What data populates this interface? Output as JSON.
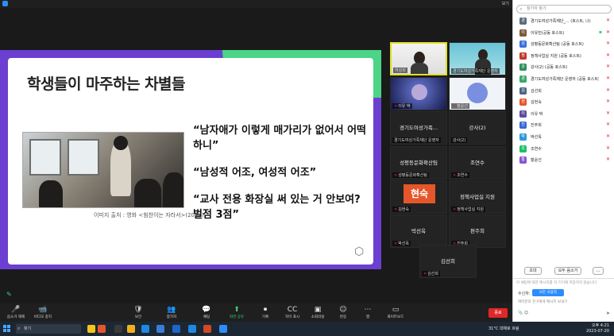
{
  "window": {
    "view_label": "보기"
  },
  "slide": {
    "title": "학생들이 마주하는 차별들",
    "caption": "이미지 출처 : 영화 <힘찬이는 자라서>(2022)",
    "quotes": [
      "“남자애가 이렇게 매가리가 없어서 어떡",
      "하니”",
      "“남성적 어조, 여성적 어조”",
      "“교사 전용 화장실 써 있는 거 안보여?",
      "벌점 3점”"
    ]
  },
  "gallery": [
    {
      "label": "여성희",
      "type": "cam1",
      "active": true
    },
    {
      "label": "경기도여성가족재단 운영자",
      "type": "cam2",
      "active": false
    },
    {
      "label": "이유 박",
      "type": "cam3",
      "active": false
    },
    {
      "label": "황윤선",
      "type": "cam4",
      "active": false
    },
    {
      "name": "경기도여성가족...",
      "label": "경기도여성가족재단 운영자",
      "type": "name"
    },
    {
      "name": "강사(2)",
      "label": "강사(2)",
      "type": "name"
    },
    {
      "name": "성평등문화확산팀",
      "label": "성평등문화확산팀",
      "type": "name"
    },
    {
      "name": "조연수",
      "label": "조연수",
      "type": "name"
    },
    {
      "avatar": "현숙",
      "label": "김현숙",
      "type": "avatar"
    },
    {
      "name": "정책사업실 지원",
      "label": "정책사업실 지원",
      "type": "name"
    },
    {
      "name": "박선옥",
      "label": "박선옥",
      "type": "name"
    },
    {
      "name": "편주희",
      "label": "진주희",
      "type": "name"
    },
    {
      "name": "김선희",
      "label": "김선희",
      "type": "name"
    }
  ],
  "toolbar": {
    "items": [
      {
        "icon": "🎤",
        "label": "음소거 해제",
        "green": false
      },
      {
        "icon": "📹",
        "label": "비디오 중지",
        "green": false
      },
      {
        "icon": "🛡",
        "label": "보안",
        "green": false
      },
      {
        "icon": "👥",
        "label": "참가자",
        "green": false
      },
      {
        "icon": "💬",
        "label": "채팅",
        "green": false
      },
      {
        "icon": "⬆",
        "label": "화면 공유",
        "green": true
      },
      {
        "icon": "⏺",
        "label": "기록",
        "green": false
      },
      {
        "icon": "CC",
        "label": "자막 표시",
        "green": false
      },
      {
        "icon": "▣",
        "label": "소회의실",
        "green": false
      },
      {
        "icon": "☺",
        "label": "반응",
        "green": false
      },
      {
        "icon": "⋯",
        "label": "앱",
        "green": false
      },
      {
        "icon": "▭",
        "label": "화이트보드",
        "green": false
      }
    ],
    "end_label": "종료"
  },
  "panel": {
    "search_placeholder": "참가자 찾기",
    "participants": [
      {
        "name": "경기도여성가족재단_... (호스트, 나)",
        "color": "#5a6b7c",
        "initial": "경",
        "status2": ""
      },
      {
        "name": "이유빈(공동 호스트)",
        "color": "#7a5a3c",
        "initial": "이",
        "status2": "▪"
      },
      {
        "name": "성평등문화확산팀 (공동 호스트)",
        "color": "#3a6fd8",
        "initial": "성",
        "status2": ""
      },
      {
        "name": "정책사업실 지원 (공동 호스트)",
        "color": "#c0392b",
        "initial": "정",
        "status2": ""
      },
      {
        "name": "강사(2) (공동 호스트)",
        "color": "#2c8f5a",
        "initial": "강",
        "status2": ""
      },
      {
        "name": "경기도여성가족재단 운영자 (공동 호스트)",
        "color": "#3aa66a",
        "initial": "경",
        "status2": ""
      },
      {
        "name": "김선희",
        "color": "#4b6584",
        "initial": "김",
        "status2": ""
      },
      {
        "name": "김현숙",
        "color": "#e5562b",
        "initial": "현",
        "status2": ""
      },
      {
        "name": "이유 박",
        "color": "#5d4a9c",
        "initial": "이",
        "status2": ""
      },
      {
        "name": "진주희",
        "color": "#3867d6",
        "initial": "진",
        "status2": ""
      },
      {
        "name": "박선옥",
        "color": "#2d98da",
        "initial": "박",
        "status2": ""
      },
      {
        "name": "조연수",
        "color": "#20bf6b",
        "initial": "조",
        "status2": ""
      },
      {
        "name": "황윤선",
        "color": "#8854d0",
        "initial": "황",
        "status2": ""
      }
    ],
    "invite_label": "초대",
    "mute_all_label": "모두 음소거",
    "more_label": "...",
    "chat_notice": "이 채팅에 대한 메시지를 이 기기에 저장하지 않습니다",
    "recv_label": "수신자:",
    "recv_value": "모든 사용자",
    "chat_placeholder": "여러분의 친구에게 메시지 보내기"
  },
  "taskbar": {
    "search_placeholder": "찾기",
    "weather": "31°C 대체로 흐림",
    "time": "오후 4:21",
    "date": "2023-07-20"
  }
}
